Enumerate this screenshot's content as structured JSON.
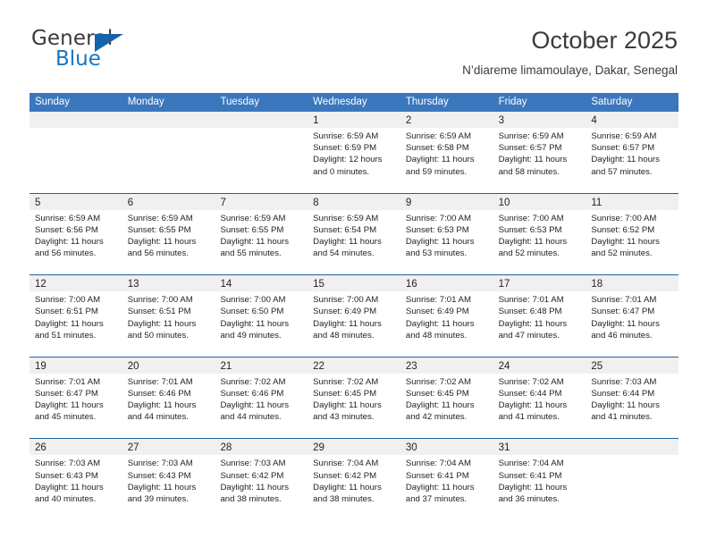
{
  "brand": {
    "name_part1": "General",
    "name_part2": "Blue",
    "accent_color": "#1577c4",
    "triangle_color": "#1464aa"
  },
  "header": {
    "title": "October 2025",
    "location": "N’diareme limamoulaye, Dakar, Senegal"
  },
  "theme": {
    "header_row_bg": "#3b77bc",
    "week_divider": "#20609f",
    "daynum_band_bg": "#f0f0f0",
    "text_color": "#231f20"
  },
  "weekdays": [
    "Sunday",
    "Monday",
    "Tuesday",
    "Wednesday",
    "Thursday",
    "Friday",
    "Saturday"
  ],
  "weeks": [
    [
      {
        "day": "",
        "sunrise": "",
        "sunset": "",
        "daylight": "",
        "empty": true
      },
      {
        "day": "",
        "sunrise": "",
        "sunset": "",
        "daylight": "",
        "empty": true
      },
      {
        "day": "",
        "sunrise": "",
        "sunset": "",
        "daylight": "",
        "empty": true
      },
      {
        "day": "1",
        "sunrise": "Sunrise: 6:59 AM",
        "sunset": "Sunset: 6:59 PM",
        "daylight": "Daylight: 12 hours and 0 minutes.",
        "empty": false
      },
      {
        "day": "2",
        "sunrise": "Sunrise: 6:59 AM",
        "sunset": "Sunset: 6:58 PM",
        "daylight": "Daylight: 11 hours and 59 minutes.",
        "empty": false
      },
      {
        "day": "3",
        "sunrise": "Sunrise: 6:59 AM",
        "sunset": "Sunset: 6:57 PM",
        "daylight": "Daylight: 11 hours and 58 minutes.",
        "empty": false
      },
      {
        "day": "4",
        "sunrise": "Sunrise: 6:59 AM",
        "sunset": "Sunset: 6:57 PM",
        "daylight": "Daylight: 11 hours and 57 minutes.",
        "empty": false
      }
    ],
    [
      {
        "day": "5",
        "sunrise": "Sunrise: 6:59 AM",
        "sunset": "Sunset: 6:56 PM",
        "daylight": "Daylight: 11 hours and 56 minutes.",
        "empty": false
      },
      {
        "day": "6",
        "sunrise": "Sunrise: 6:59 AM",
        "sunset": "Sunset: 6:55 PM",
        "daylight": "Daylight: 11 hours and 56 minutes.",
        "empty": false
      },
      {
        "day": "7",
        "sunrise": "Sunrise: 6:59 AM",
        "sunset": "Sunset: 6:55 PM",
        "daylight": "Daylight: 11 hours and 55 minutes.",
        "empty": false
      },
      {
        "day": "8",
        "sunrise": "Sunrise: 6:59 AM",
        "sunset": "Sunset: 6:54 PM",
        "daylight": "Daylight: 11 hours and 54 minutes.",
        "empty": false
      },
      {
        "day": "9",
        "sunrise": "Sunrise: 7:00 AM",
        "sunset": "Sunset: 6:53 PM",
        "daylight": "Daylight: 11 hours and 53 minutes.",
        "empty": false
      },
      {
        "day": "10",
        "sunrise": "Sunrise: 7:00 AM",
        "sunset": "Sunset: 6:53 PM",
        "daylight": "Daylight: 11 hours and 52 minutes.",
        "empty": false
      },
      {
        "day": "11",
        "sunrise": "Sunrise: 7:00 AM",
        "sunset": "Sunset: 6:52 PM",
        "daylight": "Daylight: 11 hours and 52 minutes.",
        "empty": false
      }
    ],
    [
      {
        "day": "12",
        "sunrise": "Sunrise: 7:00 AM",
        "sunset": "Sunset: 6:51 PM",
        "daylight": "Daylight: 11 hours and 51 minutes.",
        "empty": false
      },
      {
        "day": "13",
        "sunrise": "Sunrise: 7:00 AM",
        "sunset": "Sunset: 6:51 PM",
        "daylight": "Daylight: 11 hours and 50 minutes.",
        "empty": false
      },
      {
        "day": "14",
        "sunrise": "Sunrise: 7:00 AM",
        "sunset": "Sunset: 6:50 PM",
        "daylight": "Daylight: 11 hours and 49 minutes.",
        "empty": false
      },
      {
        "day": "15",
        "sunrise": "Sunrise: 7:00 AM",
        "sunset": "Sunset: 6:49 PM",
        "daylight": "Daylight: 11 hours and 48 minutes.",
        "empty": false
      },
      {
        "day": "16",
        "sunrise": "Sunrise: 7:01 AM",
        "sunset": "Sunset: 6:49 PM",
        "daylight": "Daylight: 11 hours and 48 minutes.",
        "empty": false
      },
      {
        "day": "17",
        "sunrise": "Sunrise: 7:01 AM",
        "sunset": "Sunset: 6:48 PM",
        "daylight": "Daylight: 11 hours and 47 minutes.",
        "empty": false
      },
      {
        "day": "18",
        "sunrise": "Sunrise: 7:01 AM",
        "sunset": "Sunset: 6:47 PM",
        "daylight": "Daylight: 11 hours and 46 minutes.",
        "empty": false
      }
    ],
    [
      {
        "day": "19",
        "sunrise": "Sunrise: 7:01 AM",
        "sunset": "Sunset: 6:47 PM",
        "daylight": "Daylight: 11 hours and 45 minutes.",
        "empty": false
      },
      {
        "day": "20",
        "sunrise": "Sunrise: 7:01 AM",
        "sunset": "Sunset: 6:46 PM",
        "daylight": "Daylight: 11 hours and 44 minutes.",
        "empty": false
      },
      {
        "day": "21",
        "sunrise": "Sunrise: 7:02 AM",
        "sunset": "Sunset: 6:46 PM",
        "daylight": "Daylight: 11 hours and 44 minutes.",
        "empty": false
      },
      {
        "day": "22",
        "sunrise": "Sunrise: 7:02 AM",
        "sunset": "Sunset: 6:45 PM",
        "daylight": "Daylight: 11 hours and 43 minutes.",
        "empty": false
      },
      {
        "day": "23",
        "sunrise": "Sunrise: 7:02 AM",
        "sunset": "Sunset: 6:45 PM",
        "daylight": "Daylight: 11 hours and 42 minutes.",
        "empty": false
      },
      {
        "day": "24",
        "sunrise": "Sunrise: 7:02 AM",
        "sunset": "Sunset: 6:44 PM",
        "daylight": "Daylight: 11 hours and 41 minutes.",
        "empty": false
      },
      {
        "day": "25",
        "sunrise": "Sunrise: 7:03 AM",
        "sunset": "Sunset: 6:44 PM",
        "daylight": "Daylight: 11 hours and 41 minutes.",
        "empty": false
      }
    ],
    [
      {
        "day": "26",
        "sunrise": "Sunrise: 7:03 AM",
        "sunset": "Sunset: 6:43 PM",
        "daylight": "Daylight: 11 hours and 40 minutes.",
        "empty": false
      },
      {
        "day": "27",
        "sunrise": "Sunrise: 7:03 AM",
        "sunset": "Sunset: 6:43 PM",
        "daylight": "Daylight: 11 hours and 39 minutes.",
        "empty": false
      },
      {
        "day": "28",
        "sunrise": "Sunrise: 7:03 AM",
        "sunset": "Sunset: 6:42 PM",
        "daylight": "Daylight: 11 hours and 38 minutes.",
        "empty": false
      },
      {
        "day": "29",
        "sunrise": "Sunrise: 7:04 AM",
        "sunset": "Sunset: 6:42 PM",
        "daylight": "Daylight: 11 hours and 38 minutes.",
        "empty": false
      },
      {
        "day": "30",
        "sunrise": "Sunrise: 7:04 AM",
        "sunset": "Sunset: 6:41 PM",
        "daylight": "Daylight: 11 hours and 37 minutes.",
        "empty": false
      },
      {
        "day": "31",
        "sunrise": "Sunrise: 7:04 AM",
        "sunset": "Sunset: 6:41 PM",
        "daylight": "Daylight: 11 hours and 36 minutes.",
        "empty": false
      },
      {
        "day": "",
        "sunrise": "",
        "sunset": "",
        "daylight": "",
        "empty": true
      }
    ]
  ]
}
